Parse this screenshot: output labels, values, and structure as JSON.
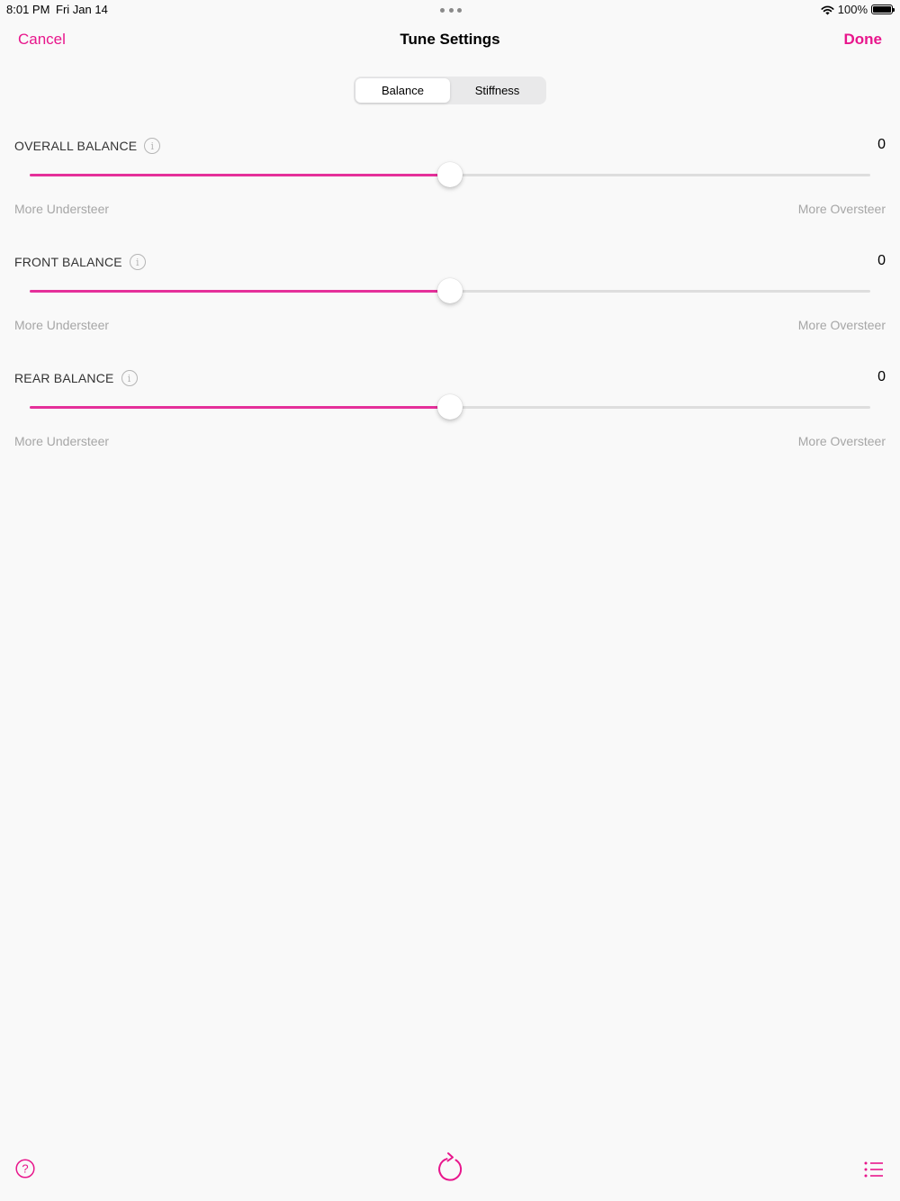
{
  "status_bar": {
    "time": "8:01 PM",
    "date": "Fri Jan 14",
    "battery": "100%"
  },
  "nav": {
    "cancel_label": "Cancel",
    "title": "Tune Settings",
    "done_label": "Done"
  },
  "tabs": {
    "items": [
      {
        "label": "Balance",
        "active": true
      },
      {
        "label": "Stiffness",
        "active": false
      }
    ]
  },
  "settings": [
    {
      "label": "OVERALL BALANCE",
      "value": "0",
      "min_label": "More Understeer",
      "max_label": "More Oversteer",
      "level": 0.5
    },
    {
      "label": "FRONT BALANCE",
      "value": "0",
      "min_label": "More Understeer",
      "max_label": "More Oversteer",
      "level": 0.5
    },
    {
      "label": "REAR BALANCE",
      "value": "0",
      "min_label": "More Understeer",
      "max_label": "More Oversteer",
      "level": 0.5
    }
  ],
  "toolbar": {
    "icons": [
      "help-icon",
      "reset-icon",
      "list-icon"
    ]
  },
  "colors": {
    "accent": "#e8168c",
    "slider_fill": "#e5309a",
    "track": "#dedede",
    "background": "#f9f9f9"
  }
}
